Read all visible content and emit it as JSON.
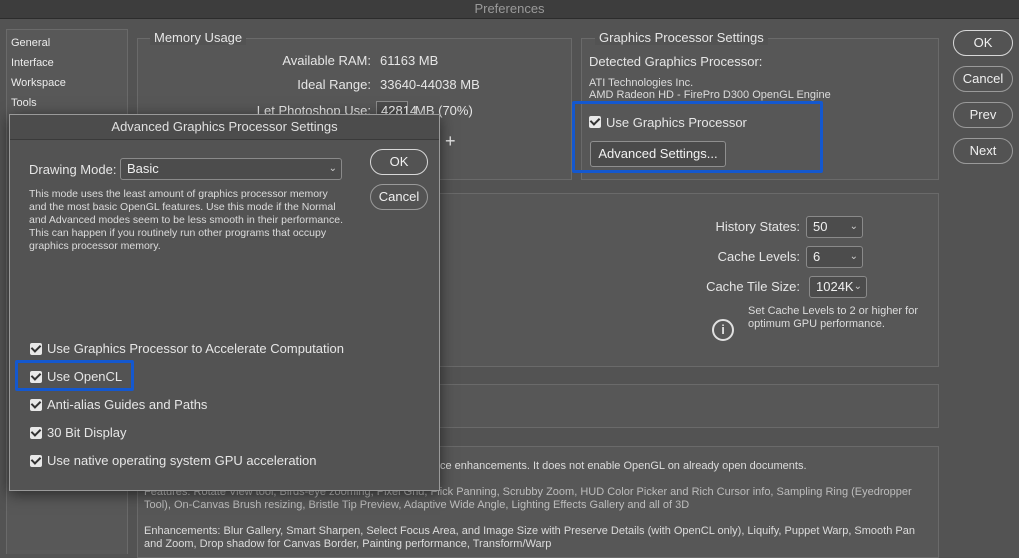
{
  "window": {
    "title": "Preferences"
  },
  "sidebar": {
    "items": [
      {
        "label": "General"
      },
      {
        "label": "Interface"
      },
      {
        "label": "Workspace"
      },
      {
        "label": "Tools"
      }
    ]
  },
  "memory": {
    "title": "Memory Usage",
    "available_ram_label": "Available RAM:",
    "available_ram_value": "61163 MB",
    "ideal_range_label": "Ideal Range:",
    "ideal_range_value": "33640-44038 MB",
    "let_use_label": "Let Photoshop Use:",
    "let_use_value": "42814",
    "let_use_unit": "MB (70%)",
    "plus": "+"
  },
  "gpu": {
    "title": "Graphics Processor Settings",
    "detected_label": "Detected Graphics Processor:",
    "vendor": "ATI Technologies Inc.",
    "model": "AMD Radeon HD - FirePro D300 OpenGL Engine",
    "use_gpu_label": "Use Graphics Processor",
    "advanced_button": "Advanced Settings..."
  },
  "history": {
    "history_states_label": "History States:",
    "history_states_value": "50",
    "cache_levels_label": "Cache Levels:",
    "cache_levels_value": "6",
    "cache_tile_label": "Cache Tile Size:",
    "cache_tile_value": "1024K",
    "note": "Set Cache Levels to 2 or higher for optimum GPU performance."
  },
  "buttons": {
    "ok": "OK",
    "cancel": "Cancel",
    "prev": "Prev",
    "next": "Next"
  },
  "description": {
    "line1": "ce enhancements. It does not enable OpenGL on already open documents.",
    "features": "Features: Rotate View tool, Birds-eye zooming, Pixel Grid, Flick Panning, Scrubby Zoom, HUD Color Picker and Rich Cursor info, Sampling Ring (Eyedropper Tool), On-Canvas Brush resizing, Bristle Tip Preview, Adaptive Wide Angle, Lighting Effects Gallery and all of 3D",
    "enhancements": "Enhancements: Blur Gallery, Smart Sharpen, Select Focus Area, and Image Size with Preserve Details (with OpenCL only), Liquify, Puppet Warp, Smooth Pan and Zoom, Drop shadow for Canvas Border, Painting performance, Transform/Warp"
  },
  "dialog": {
    "title": "Advanced Graphics Processor Settings",
    "drawing_mode_label": "Drawing Mode:",
    "drawing_mode_value": "Basic",
    "ok": "OK",
    "cancel": "Cancel",
    "mode_description": "This mode uses the least amount of graphics processor memory and the most basic OpenGL features.  Use this mode if the Normal and Advanced modes seem to be less smooth in their performance.  This can happen if you routinely run other programs that occupy graphics processor memory.",
    "options": [
      {
        "label": "Use Graphics Processor to Accelerate Computation"
      },
      {
        "label": "Use OpenCL"
      },
      {
        "label": "Anti-alias Guides and Paths"
      },
      {
        "label": "30 Bit Display"
      },
      {
        "label": "Use native operating system GPU acceleration"
      }
    ]
  },
  "colors": {
    "highlight": "#1458cf",
    "background": "#535353"
  }
}
